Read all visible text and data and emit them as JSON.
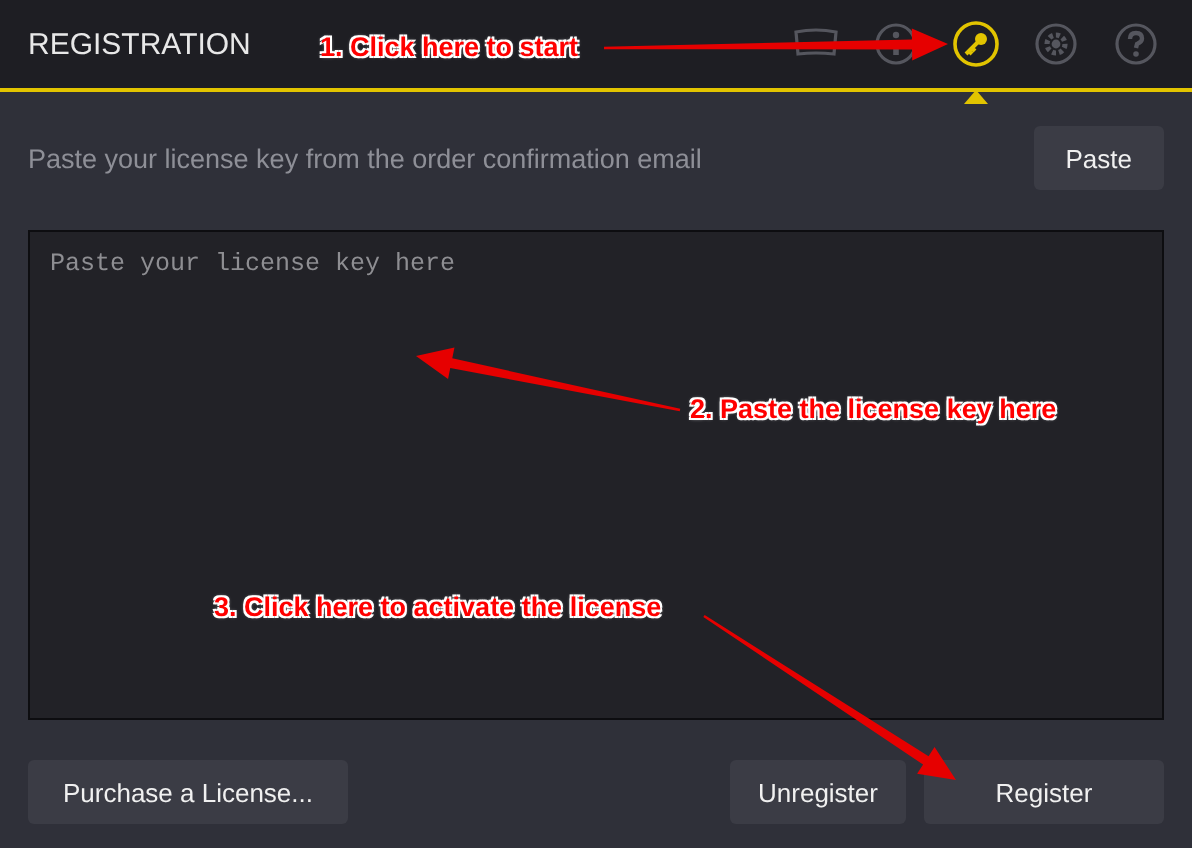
{
  "window": {
    "title": "REGISTRATION"
  },
  "toolbar": [
    {
      "kind": "display",
      "selected": false
    },
    {
      "kind": "info",
      "selected": false
    },
    {
      "kind": "key",
      "selected": true
    },
    {
      "kind": "settings",
      "selected": false
    },
    {
      "kind": "help",
      "selected": false
    }
  ],
  "instruction": "Paste your license key from the order confirmation email",
  "paste_button": "Paste",
  "license_field": {
    "placeholder": "Paste your license key here"
  },
  "buttons": {
    "purchase": "Purchase a License...",
    "unregister": "Unregister",
    "register": "Register"
  },
  "annotations": [
    {
      "text": "1. Click here to start"
    },
    {
      "text": "2. Paste the license key here"
    },
    {
      "text": "3. Click here to activate the license"
    }
  ]
}
